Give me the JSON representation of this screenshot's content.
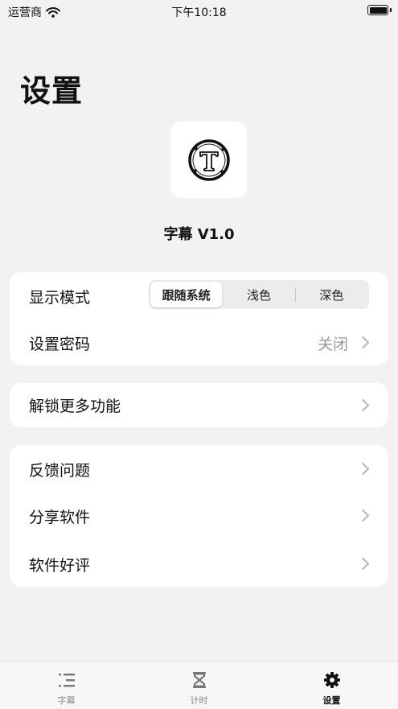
{
  "status_bar": {
    "carrier": "运营商",
    "time": "下午10:18"
  },
  "header": {
    "title": "设置"
  },
  "app": {
    "name": "字幕 V1.0",
    "icon": "letter-t-logo-icon"
  },
  "display_mode": {
    "label": "显示模式",
    "options": [
      "跟随系统",
      "浅色",
      "深色"
    ],
    "selected": "跟随系统"
  },
  "password": {
    "label": "设置密码",
    "value": "关闭"
  },
  "unlock": {
    "label": "解锁更多功能"
  },
  "feedback": {
    "label": "反馈问题"
  },
  "share": {
    "label": "分享软件"
  },
  "review": {
    "label": "软件好评"
  },
  "tabs": [
    {
      "label": "字幕",
      "icon": "list-icon"
    },
    {
      "label": "计时",
      "icon": "hourglass-icon"
    },
    {
      "label": "设置",
      "icon": "gear-icon"
    }
  ],
  "active_tab": "设置"
}
